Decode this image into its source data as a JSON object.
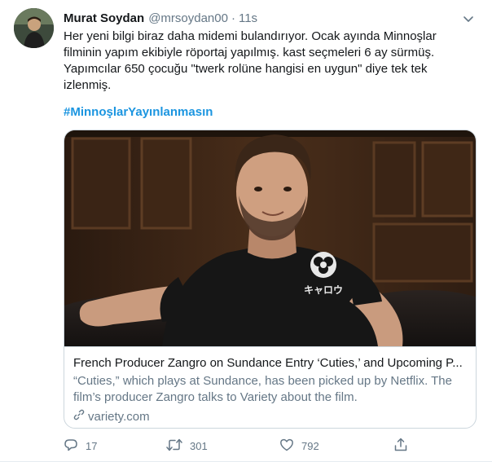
{
  "author": {
    "name": "Murat Soydan",
    "handle": "@mrsoydan00",
    "separator": "·",
    "time": "11s"
  },
  "tweet": {
    "lines": [
      "Her yeni bilgi biraz daha midemi bulandırıyor. Ocak ayında Minnoşlar",
      "filminin yapım ekibiyle röportaj yapılmış. kast seçmeleri 6 ay sürmüş.",
      "Yapımcılar 650 çocuğu \"twerk rolüne hangisi en uygun\" diye tek tek",
      "izlenmiş."
    ],
    "hashtag": "#MinnoşlarYayınlanmasın"
  },
  "card": {
    "title": "French Producer Zangro on Sundance Entry ‘Cuties,’ and Upcoming P...",
    "description_lines": [
      "“Cuties,” which plays at Sundance, has been picked up by Netflix. The",
      "film’s producer Zangro talks to Variety about the film."
    ],
    "domain": "variety.com",
    "shirt_text": "キャロウ"
  },
  "actions": {
    "replies": "17",
    "retweets": "301",
    "likes": "792"
  },
  "icons": {
    "reply": "reply-icon",
    "retweet": "retweet-icon",
    "like": "heart-icon",
    "share": "share-icon",
    "link": "link-icon",
    "more": "chevron-down-icon"
  },
  "colors": {
    "text": "#14171a",
    "secondary": "#657786",
    "link": "#1b95e0",
    "border": "#ccd6dd"
  }
}
